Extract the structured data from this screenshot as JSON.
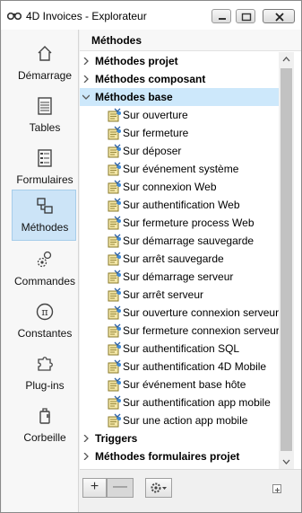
{
  "window": {
    "title": "4D Invoices - Explorateur",
    "app_icon": "binoculars-icon"
  },
  "sidebar": {
    "items": [
      {
        "label": "Démarrage",
        "icon": "home-icon",
        "active": false
      },
      {
        "label": "Tables",
        "icon": "table-icon",
        "active": false
      },
      {
        "label": "Formulaires",
        "icon": "form-icon",
        "active": false
      },
      {
        "label": "Méthodes",
        "icon": "methods-icon",
        "active": true
      },
      {
        "label": "Commandes",
        "icon": "commands-gear-icon",
        "active": false
      },
      {
        "label": "Constantes",
        "icon": "pi-constant-icon",
        "active": false
      },
      {
        "label": "Plug-ins",
        "icon": "puzzle-icon",
        "active": false
      },
      {
        "label": "Corbeille",
        "icon": "trash-icon",
        "active": false
      }
    ]
  },
  "main": {
    "header": "Méthodes",
    "groups": {
      "projet": "Méthodes projet",
      "composant": "Méthodes composant",
      "base": "Méthodes base",
      "triggers": "Triggers",
      "formulaires": "Méthodes formulaires projet"
    },
    "base_methods": [
      "Sur ouverture",
      "Sur fermeture",
      "Sur déposer",
      "Sur événement système",
      "Sur connexion Web",
      "Sur authentification Web",
      "Sur fermeture process Web",
      "Sur démarrage sauvegarde",
      "Sur arrêt sauvegarde",
      "Sur démarrage serveur",
      "Sur arrêt serveur",
      "Sur ouverture connexion serveur",
      "Sur fermeture connexion serveur",
      "Sur authentification SQL",
      "Sur authentification 4D Mobile",
      "Sur événement base hôte",
      "Sur authentification app mobile",
      "Sur une action app mobile"
    ]
  },
  "toolbar": {
    "add_label": "+",
    "remove_label": "—"
  },
  "colors": {
    "selection": "#cde8fb",
    "sidebar_active": "#cce4f7"
  }
}
